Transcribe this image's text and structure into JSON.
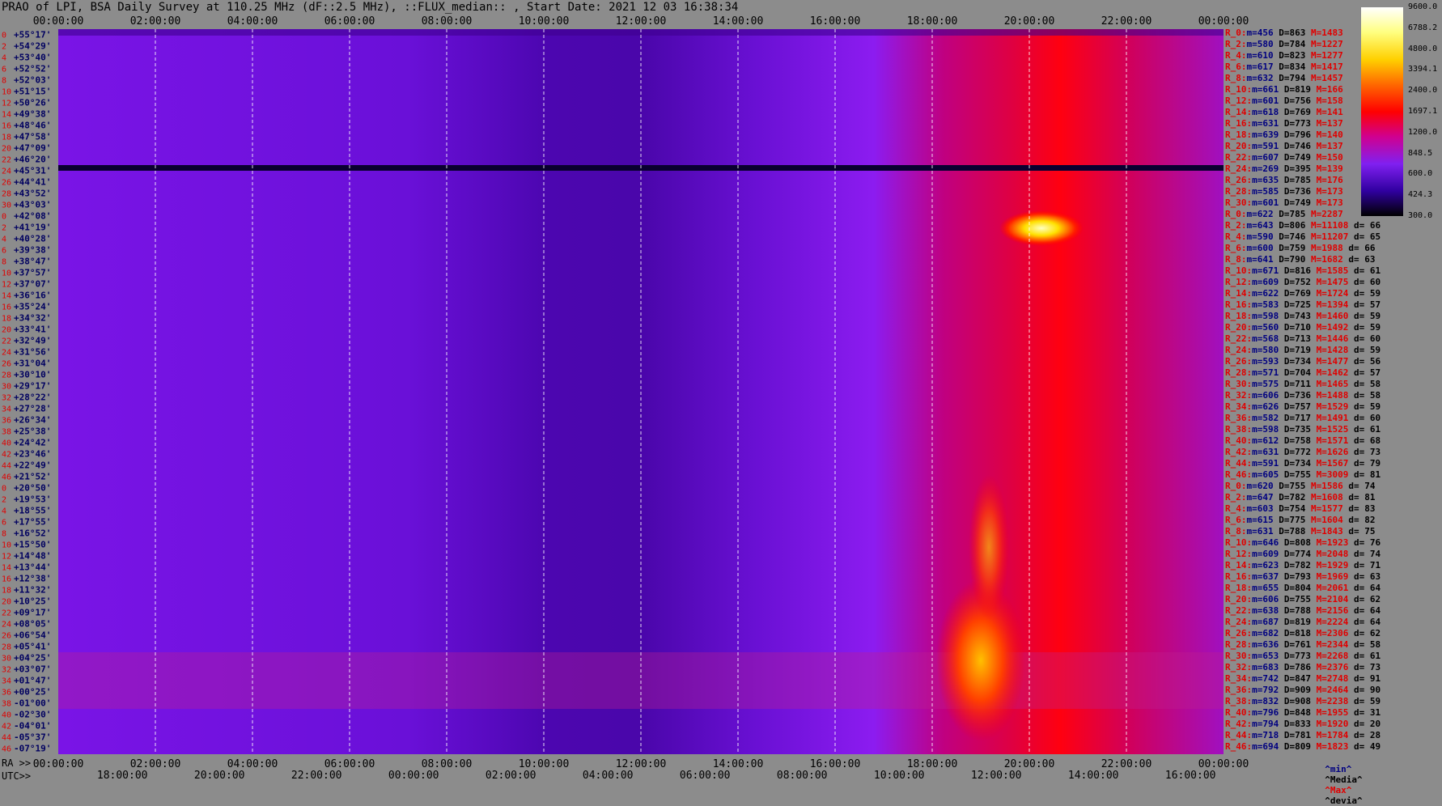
{
  "title": "PRAO of LPI, BSA Daily Survey at 110.25 MHz (dF::2.5 MHz), ::FLUX_median:: , Start Date: 2021 12 03 16:38:34",
  "chart_data": {
    "type": "heatmap",
    "x_top_labels": [
      "00:00:00",
      "02:00:00",
      "04:00:00",
      "06:00:00",
      "08:00:00",
      "10:00:00",
      "12:00:00",
      "14:00:00",
      "16:00:00",
      "18:00:00",
      "20:00:00",
      "22:00:00",
      "00:00:00"
    ],
    "x_bottom_ra_labels": [
      "00:00:00",
      "02:00:00",
      "04:00:00",
      "06:00:00",
      "08:00:00",
      "10:00:00",
      "12:00:00",
      "14:00:00",
      "16:00:00",
      "18:00:00",
      "20:00:00",
      "22:00:00",
      "00:00:00"
    ],
    "x_bottom_utc_labels": [
      "18:00:00",
      "20:00:00",
      "22:00:00",
      "00:00:00",
      "02:00:00",
      "04:00:00",
      "06:00:00",
      "08:00:00",
      "10:00:00",
      "12:00:00",
      "14:00:00",
      "16:00:00"
    ],
    "bottom_ra_prefix": "RA >>",
    "bottom_utc_prefix": "UTC>>",
    "y_labels": [
      "+55°17'",
      "+54°29'",
      "+53°40'",
      "+52°52'",
      "+52°03'",
      "+51°15'",
      "+50°26'",
      "+49°38'",
      "+48°46'",
      "+47°58'",
      "+47°09'",
      "+46°20'",
      "+45°31'",
      "+44°41'",
      "+43°52'",
      "+43°03'",
      "+42°08'",
      "+41°19'",
      "+40°28'",
      "+39°38'",
      "+38°47'",
      "+37°57'",
      "+37°07'",
      "+36°16'",
      "+35°24'",
      "+34°32'",
      "+33°41'",
      "+32°49'",
      "+31°56'",
      "+31°04'",
      "+30°10'",
      "+29°17'",
      "+28°22'",
      "+27°28'",
      "+26°34'",
      "+25°38'",
      "+24°42'",
      "+23°46'",
      "+22°49'",
      "+21°52'",
      "+20°50'",
      "+19°53'",
      "+18°55'",
      "+17°55'",
      "+16°52'",
      "+15°50'",
      "+14°48'",
      "+13°44'",
      "+12°38'",
      "+11°32'",
      "+10°25'",
      "+09°17'",
      "+08°05'",
      "+06°54'",
      "+05°41'",
      "+04°25'",
      "+03°07'",
      "+01°47'",
      "+00°25'",
      "-01°00'",
      "-02°30'",
      "-04°01'",
      "-05°37'",
      "-07°19'"
    ],
    "y_index_labels": [
      "0",
      "2",
      "4",
      "6",
      "8",
      "10",
      "12",
      "14",
      "16",
      "18",
      "20",
      "22",
      "24",
      "26",
      "28",
      "30",
      "0",
      "2",
      "4",
      "6",
      "8",
      "10",
      "12",
      "14",
      "16",
      "18",
      "20",
      "22",
      "24",
      "26",
      "28",
      "30",
      "32",
      "34",
      "36",
      "38",
      "40",
      "42",
      "44",
      "46",
      "0",
      "2",
      "4",
      "6",
      "8",
      "10",
      "12",
      "14",
      "16",
      "18",
      "20",
      "22",
      "24",
      "26",
      "28",
      "30",
      "32",
      "34",
      "36",
      "38",
      "40",
      "42",
      "44",
      "46"
    ],
    "colorbar_ticks": [
      "9600.0",
      "6788.2",
      "4800.0",
      "3394.1",
      "2400.0",
      "1697.1",
      "1200.0",
      "848.5",
      "600.0",
      "424.3",
      "300.0"
    ],
    "colorbar_range": [
      300.0,
      9600.0
    ],
    "scale": "log",
    "colors": {
      "low": "#000000",
      "mid_low": "#6a00d0",
      "mid": "#9b1ef2",
      "high": "#ff0000",
      "top": "#ffff00",
      "max": "#ffffff",
      "grid": "#ffffff"
    },
    "row_stats": [
      {
        "name": "R_0:",
        "m": "456",
        "d": "863",
        "mx": "1483",
        "dev": ""
      },
      {
        "name": "R_2:",
        "m": "580",
        "d": "784",
        "mx": "1227",
        "dev": ""
      },
      {
        "name": "R_4:",
        "m": "610",
        "d": "823",
        "mx": "1277",
        "dev": ""
      },
      {
        "name": "R_6:",
        "m": "617",
        "d": "834",
        "mx": "1417",
        "dev": ""
      },
      {
        "name": "R_8:",
        "m": "632",
        "d": "794",
        "mx": "1457",
        "dev": ""
      },
      {
        "name": "R_10:",
        "m": "661",
        "d": "819",
        "mx": "166",
        "dev": ""
      },
      {
        "name": "R_12:",
        "m": "601",
        "d": "756",
        "mx": "158",
        "dev": ""
      },
      {
        "name": "R_14:",
        "m": "618",
        "d": "769",
        "mx": "141",
        "dev": ""
      },
      {
        "name": "R_16:",
        "m": "631",
        "d": "773",
        "mx": "137",
        "dev": ""
      },
      {
        "name": "R_18:",
        "m": "639",
        "d": "796",
        "mx": "140",
        "dev": ""
      },
      {
        "name": "R_20:",
        "m": "591",
        "d": "746",
        "mx": "137",
        "dev": ""
      },
      {
        "name": "R_22:",
        "m": "607",
        "d": "749",
        "mx": "150",
        "dev": ""
      },
      {
        "name": "R_24:",
        "m": "269",
        "d": "395",
        "mx": "139",
        "dev": ""
      },
      {
        "name": "R_26:",
        "m": "635",
        "d": "785",
        "mx": "176",
        "dev": ""
      },
      {
        "name": "R_28:",
        "m": "585",
        "d": "736",
        "mx": "173",
        "dev": ""
      },
      {
        "name": "R_30:",
        "m": "601",
        "d": "749",
        "mx": "173",
        "dev": ""
      },
      {
        "name": "R_0:",
        "m": "622",
        "d": "785",
        "mx": "2287",
        "dev": ""
      },
      {
        "name": "R_2:",
        "m": "643",
        "d": "806",
        "mx": "11108",
        "dev": "66"
      },
      {
        "name": "R_4:",
        "m": "590",
        "d": "746",
        "mx": "11207",
        "dev": "65"
      },
      {
        "name": "R_6:",
        "m": "600",
        "d": "759",
        "mx": "1988",
        "dev": "66"
      },
      {
        "name": "R_8:",
        "m": "641",
        "d": "790",
        "mx": "1682",
        "dev": "63"
      },
      {
        "name": "R_10:",
        "m": "671",
        "d": "816",
        "mx": "1585",
        "dev": "61"
      },
      {
        "name": "R_12:",
        "m": "609",
        "d": "752",
        "mx": "1475",
        "dev": "60"
      },
      {
        "name": "R_14:",
        "m": "622",
        "d": "769",
        "mx": "1724",
        "dev": "59"
      },
      {
        "name": "R_16:",
        "m": "583",
        "d": "725",
        "mx": "1394",
        "dev": "57"
      },
      {
        "name": "R_18:",
        "m": "598",
        "d": "743",
        "mx": "1460",
        "dev": "59"
      },
      {
        "name": "R_20:",
        "m": "560",
        "d": "710",
        "mx": "1492",
        "dev": "59"
      },
      {
        "name": "R_22:",
        "m": "568",
        "d": "713",
        "mx": "1446",
        "dev": "60"
      },
      {
        "name": "R_24:",
        "m": "580",
        "d": "719",
        "mx": "1428",
        "dev": "59"
      },
      {
        "name": "R_26:",
        "m": "593",
        "d": "734",
        "mx": "1477",
        "dev": "56"
      },
      {
        "name": "R_28:",
        "m": "571",
        "d": "704",
        "mx": "1462",
        "dev": "57"
      },
      {
        "name": "R_30:",
        "m": "575",
        "d": "711",
        "mx": "1465",
        "dev": "58"
      },
      {
        "name": "R_32:",
        "m": "606",
        "d": "736",
        "mx": "1488",
        "dev": "58"
      },
      {
        "name": "R_34:",
        "m": "626",
        "d": "757",
        "mx": "1529",
        "dev": "59"
      },
      {
        "name": "R_36:",
        "m": "582",
        "d": "717",
        "mx": "1491",
        "dev": "60"
      },
      {
        "name": "R_38:",
        "m": "598",
        "d": "735",
        "mx": "1525",
        "dev": "61"
      },
      {
        "name": "R_40:",
        "m": "612",
        "d": "758",
        "mx": "1571",
        "dev": "68"
      },
      {
        "name": "R_42:",
        "m": "631",
        "d": "772",
        "mx": "1626",
        "dev": "73"
      },
      {
        "name": "R_44:",
        "m": "591",
        "d": "734",
        "mx": "1567",
        "dev": "79"
      },
      {
        "name": "R_46:",
        "m": "605",
        "d": "755",
        "mx": "3009",
        "dev": "81"
      },
      {
        "name": "R_0:",
        "m": "620",
        "d": "755",
        "mx": "1586",
        "dev": "74"
      },
      {
        "name": "R_2:",
        "m": "647",
        "d": "782",
        "mx": "1608",
        "dev": "81"
      },
      {
        "name": "R_4:",
        "m": "603",
        "d": "754",
        "mx": "1577",
        "dev": "83"
      },
      {
        "name": "R_6:",
        "m": "615",
        "d": "775",
        "mx": "1604",
        "dev": "82"
      },
      {
        "name": "R_8:",
        "m": "631",
        "d": "788",
        "mx": "1843",
        "dev": "75"
      },
      {
        "name": "R_10:",
        "m": "646",
        "d": "808",
        "mx": "1923",
        "dev": "76"
      },
      {
        "name": "R_12:",
        "m": "609",
        "d": "774",
        "mx": "2048",
        "dev": "74"
      },
      {
        "name": "R_14:",
        "m": "623",
        "d": "782",
        "mx": "1929",
        "dev": "71"
      },
      {
        "name": "R_16:",
        "m": "637",
        "d": "793",
        "mx": "1969",
        "dev": "63"
      },
      {
        "name": "R_18:",
        "m": "655",
        "d": "804",
        "mx": "2061",
        "dev": "64"
      },
      {
        "name": "R_20:",
        "m": "606",
        "d": "755",
        "mx": "2104",
        "dev": "62"
      },
      {
        "name": "R_22:",
        "m": "638",
        "d": "788",
        "mx": "2156",
        "dev": "64"
      },
      {
        "name": "R_24:",
        "m": "687",
        "d": "819",
        "mx": "2224",
        "dev": "64"
      },
      {
        "name": "R_26:",
        "m": "682",
        "d": "818",
        "mx": "2306",
        "dev": "62"
      },
      {
        "name": "R_28:",
        "m": "636",
        "d": "761",
        "mx": "2344",
        "dev": "58"
      },
      {
        "name": "R_30:",
        "m": "653",
        "d": "773",
        "mx": "2268",
        "dev": "61"
      },
      {
        "name": "R_32:",
        "m": "683",
        "d": "786",
        "mx": "2376",
        "dev": "73"
      },
      {
        "name": "R_34:",
        "m": "742",
        "d": "847",
        "mx": "2748",
        "dev": "91"
      },
      {
        "name": "R_36:",
        "m": "792",
        "d": "909",
        "mx": "2464",
        "dev": "90"
      },
      {
        "name": "R_38:",
        "m": "832",
        "d": "908",
        "mx": "2238",
        "dev": "59"
      },
      {
        "name": "R_40:",
        "m": "796",
        "d": "848",
        "mx": "1955",
        "dev": "31"
      },
      {
        "name": "R_42:",
        "m": "794",
        "d": "833",
        "mx": "1920",
        "dev": "20"
      },
      {
        "name": "R_44:",
        "m": "718",
        "d": "781",
        "mx": "1784",
        "dev": "28"
      },
      {
        "name": "R_46:",
        "m": "694",
        "d": "809",
        "mx": "1823",
        "dev": "49"
      }
    ],
    "legend": [
      "^min^",
      "^Media^",
      "^Max^",
      "^devia^"
    ]
  }
}
